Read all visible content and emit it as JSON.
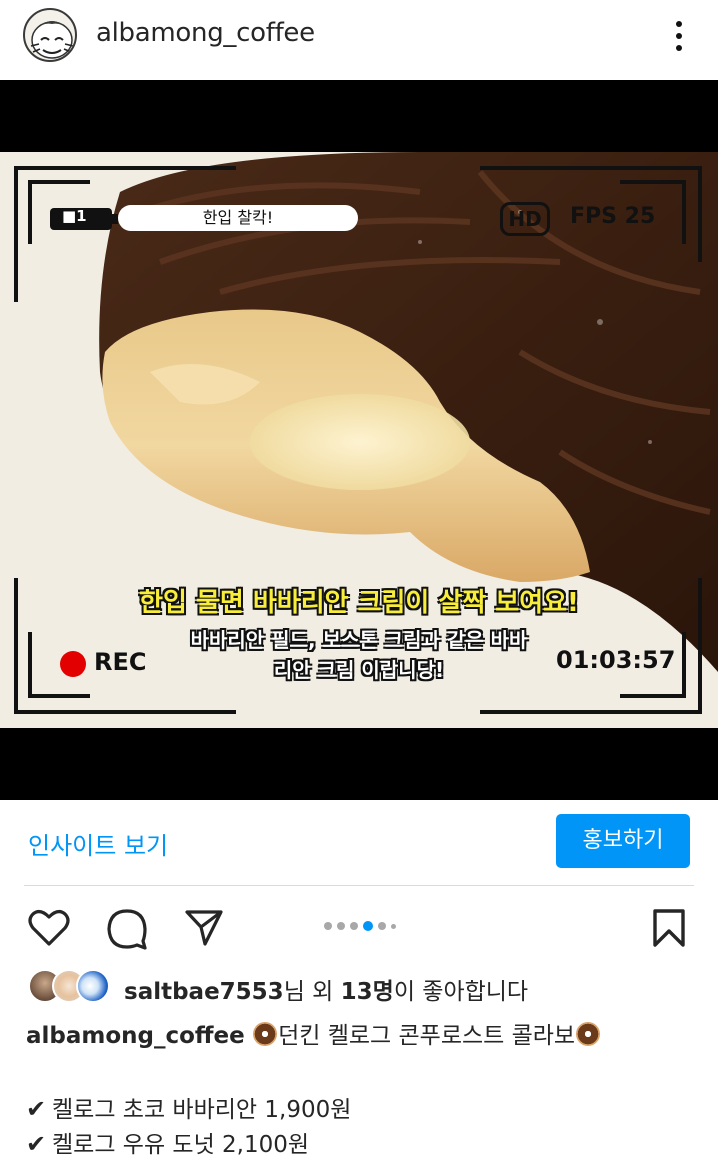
{
  "post": {
    "username": "albamong_coffee",
    "more_icon": "more-vertical-icon"
  },
  "media": {
    "overlay_label": "한입 찰칵!",
    "battery_text": "■1",
    "hd_badge": "HD",
    "fps": "FPS 25",
    "rec_label": "REC",
    "timecode": "01:03:57",
    "subtitle_main": "한입 물면 바바리안 크림이 살짝 보여요!",
    "subtitle_line1": "바바리안 필드, 보스톤 크림과 같은 바바",
    "subtitle_line2": "리안 크림 이랍니당!",
    "carousel_count": 7,
    "carousel_active_index": 3
  },
  "actions": {
    "insights_label": "인사이트 보기",
    "promote_label": "홍보하기",
    "icons": [
      "heart-icon",
      "comment-icon",
      "send-icon",
      "bookmark-icon"
    ]
  },
  "likes": {
    "user": "saltbae7553",
    "suffix_1": "님 외 ",
    "count": "13명",
    "suffix_2": "이 좋아합니다"
  },
  "caption": {
    "username": "albamong_coffee",
    "text": "던킨 켈로그 콘푸로스트 콜라보"
  },
  "menu": [
    {
      "name": "켈로그 초코 바바리안 1,900원"
    },
    {
      "name": "켈로그 우유 도넛 2,100원"
    }
  ],
  "colors": {
    "accent": "#0095f6",
    "rec_red": "#e20000",
    "subtitle_yellow": "#f7ed3a"
  }
}
